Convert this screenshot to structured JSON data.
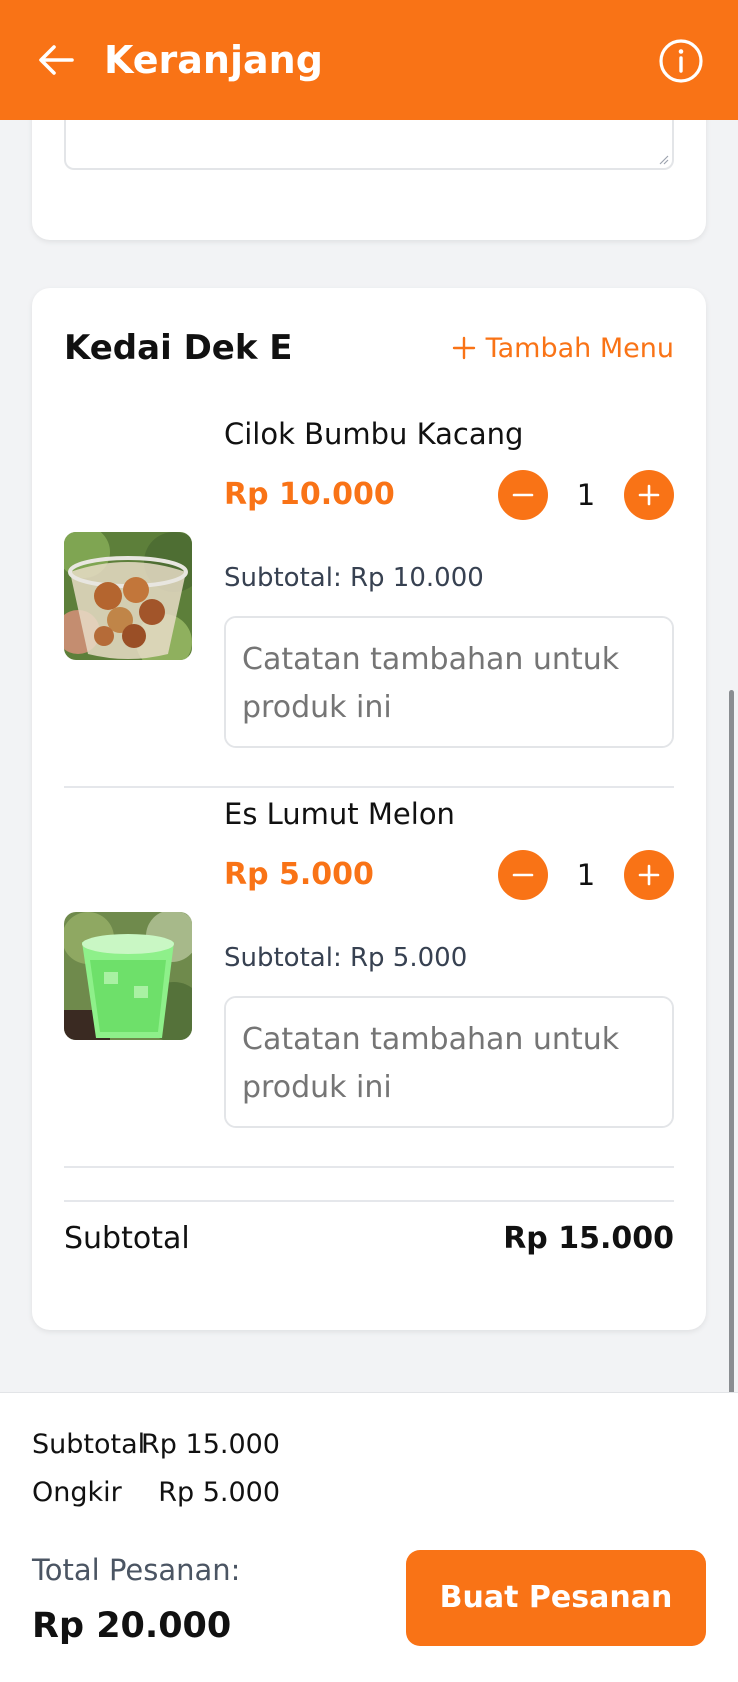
{
  "header": {
    "title": "Keranjang",
    "back_icon": "arrow-left-icon",
    "info_icon": "info-circle-icon"
  },
  "colors": {
    "accent": "#f97316",
    "background": "#f2f3f5"
  },
  "store": {
    "name": "Kedai Dek E",
    "add_menu_label": "Tambah Menu",
    "items": [
      {
        "name": "Cilok Bumbu Kacang",
        "price": "Rp 10.000",
        "quantity": "1",
        "subtotal": "Subtotal: Rp 10.000",
        "note_placeholder": "Catatan tambahan untuk produk ini"
      },
      {
        "name": "Es Lumut Melon",
        "price": "Rp 5.000",
        "quantity": "1",
        "subtotal": "Subtotal: Rp 5.000",
        "note_placeholder": "Catatan tambahan untuk produk ini"
      }
    ],
    "subtotal_label": "Subtotal",
    "subtotal_value": "Rp 15.000"
  },
  "summary": {
    "subtotal_label": "Subtotal",
    "subtotal_value": "Rp 15.000",
    "shipping_label": "Ongkir",
    "shipping_value": "Rp 5.000",
    "total_label": "Total Pesanan:",
    "total_value": "Rp 20.000",
    "order_button": "Buat Pesanan"
  }
}
